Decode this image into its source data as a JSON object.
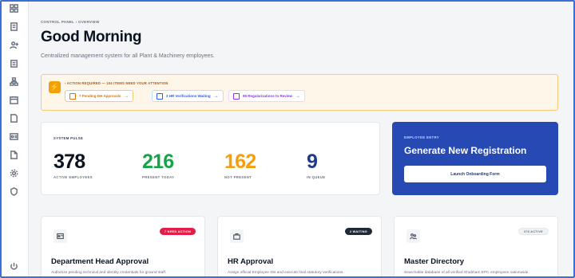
{
  "breadcrumb": "CONTROL PANEL › OVERVIEW",
  "page_title": "Good Morning",
  "subtitle": "Centralized management system for all Plant & Machinery employees.",
  "alert": {
    "icon": "bolt-icon",
    "text": "› ACTION REQUIRED — 104 ITEMS NEED YOUR ATTENTION",
    "pills": [
      {
        "label": "7 Pending DH Approvals",
        "arrow": "→",
        "color": "#d97706"
      },
      {
        "label": "2 HR Verifications Waiting",
        "arrow": "→",
        "color": "#2563eb"
      },
      {
        "label": "95 Regularizations to Review",
        "arrow": "→",
        "color": "#9333ea"
      }
    ]
  },
  "pulse": {
    "label": "SYSTEM PULSE",
    "stats": [
      {
        "value": "378",
        "label": "ACTIVE EMPLOYEES",
        "color": "#0b1220"
      },
      {
        "value": "216",
        "label": "PRESENT TODAY",
        "color": "#16a34a"
      },
      {
        "value": "162",
        "label": "NOT PRESENT",
        "color": "#f59e0b"
      },
      {
        "value": "9",
        "label": "IN QUEUE",
        "color": "#1e3a8a"
      }
    ]
  },
  "entry": {
    "label": "EMPLOYEE ENTRY",
    "title": "Generate New Registration",
    "button": "Launch Onboarding Form"
  },
  "cards": [
    {
      "title": "Department Head Approval",
      "desc": "Authorize pending technical and identity credentials for ground staff.",
      "badge": "7 NEED ACTION",
      "icon": "id-card-icon"
    },
    {
      "title": "HR Approval",
      "desc": "Assign official Employee IDs and execute final statutory verifications.",
      "badge": "2 WAITING",
      "icon": "briefcase-icon"
    },
    {
      "title": "Master Directory",
      "desc": "Searchable database of all verified Shubham EPC employees nationwide.",
      "badge": "378 ACTIVE",
      "icon": "users-icon"
    }
  ],
  "colors": {
    "accent": "#2749b4",
    "warning": "#f59e0b",
    "danger": "#e11d48",
    "success": "#16a34a"
  }
}
